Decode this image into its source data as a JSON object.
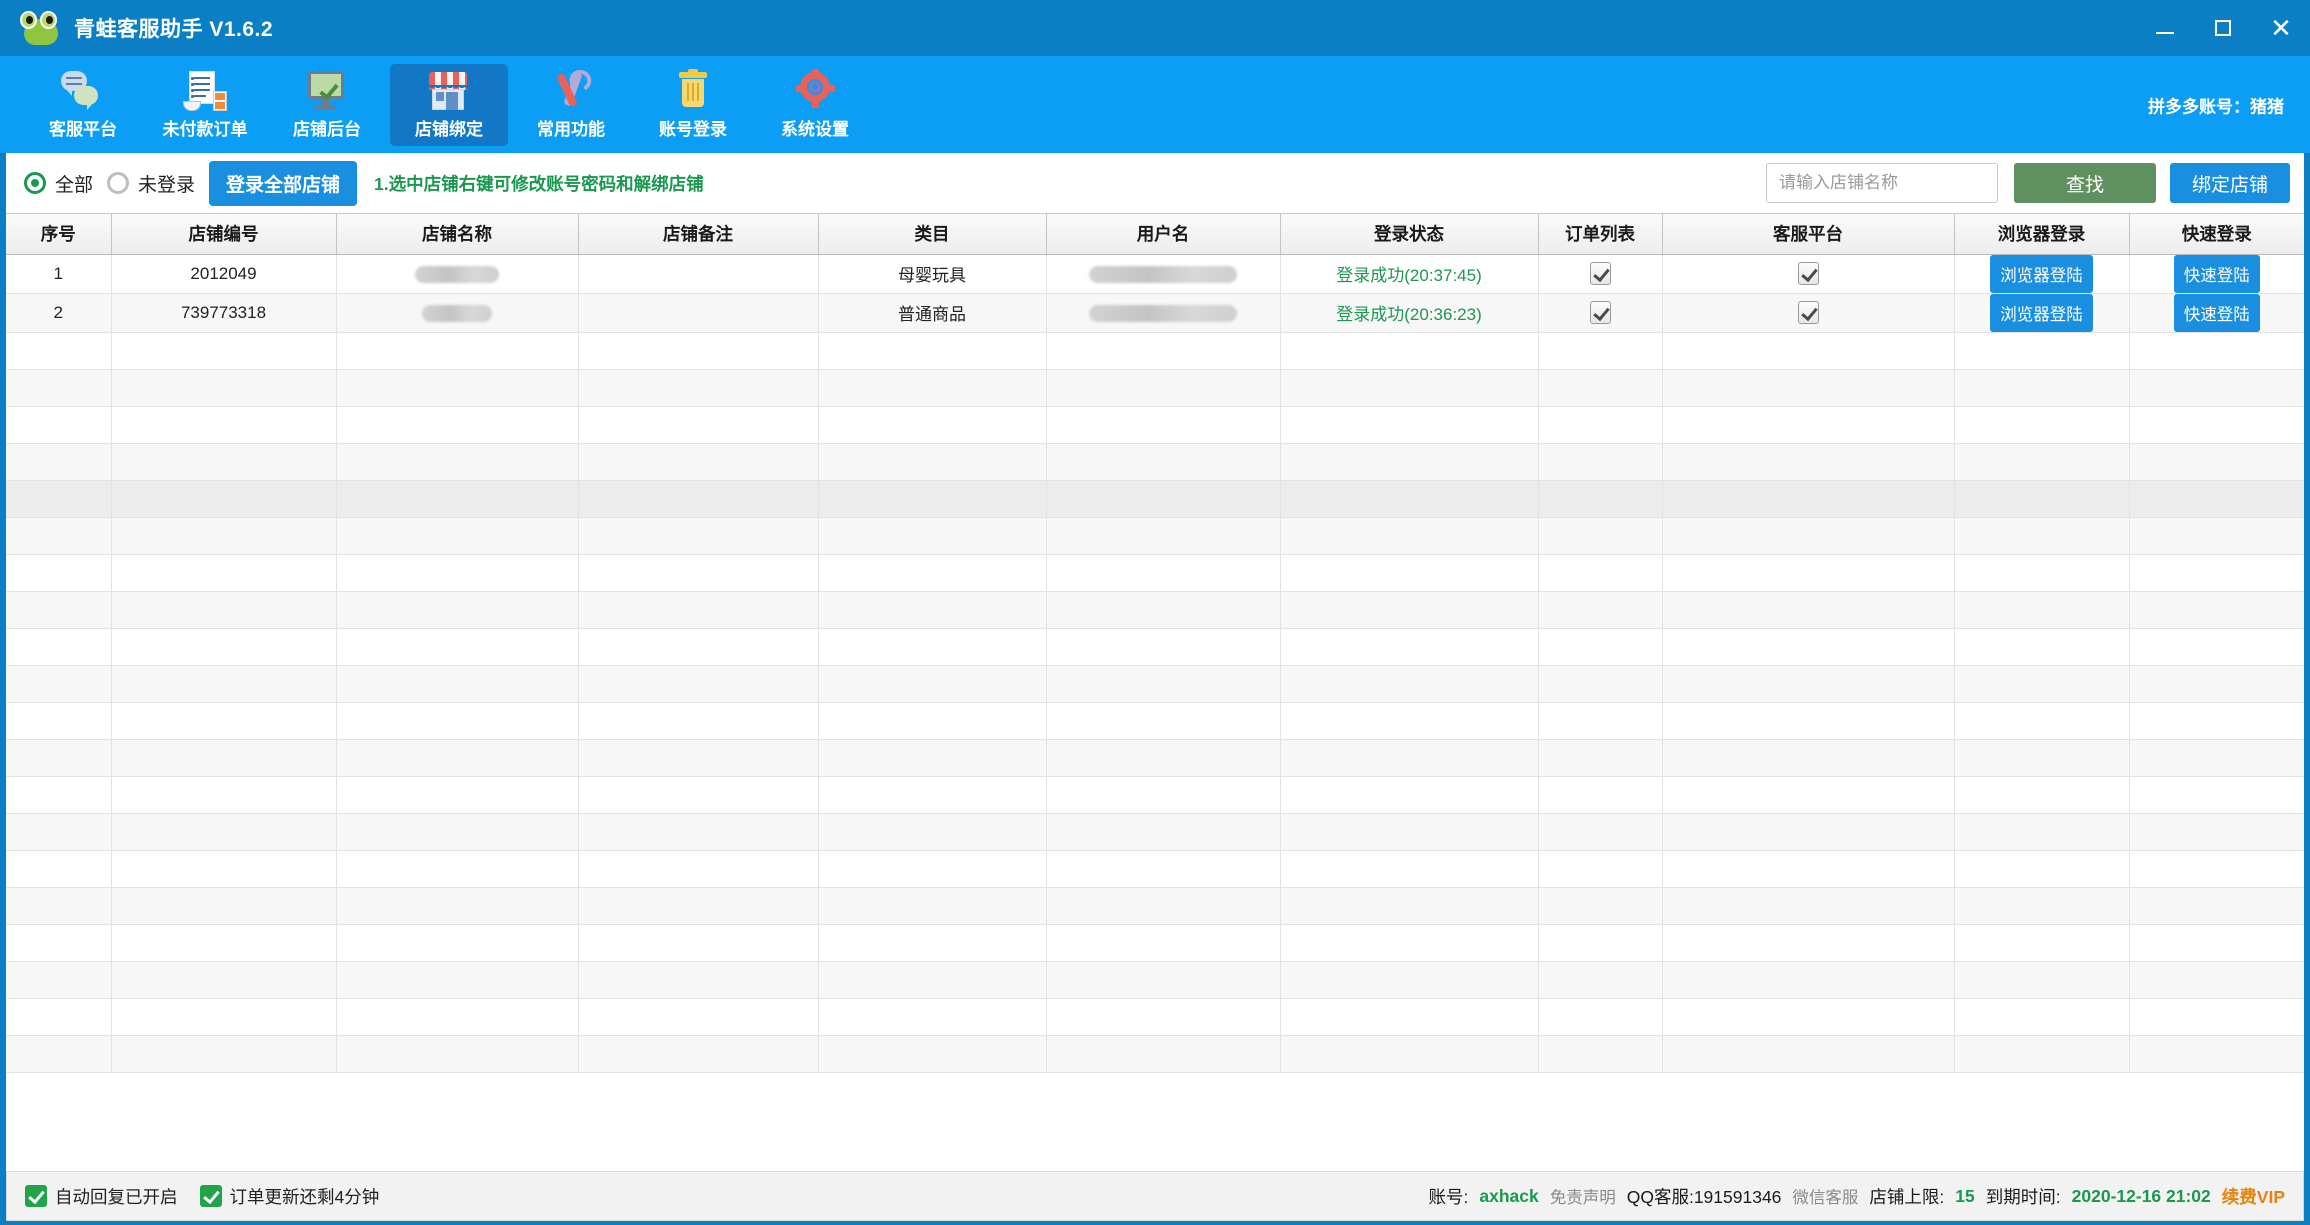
{
  "window": {
    "title": "青蛙客服助手 V1.6.2",
    "minimize": "—",
    "maximize": "□",
    "close": "✕"
  },
  "toolbar": {
    "items": [
      {
        "label": "客服平台",
        "icon": "chat-bubbles-icon",
        "active": false
      },
      {
        "label": "未付款订单",
        "icon": "invoice-hourglass-icon",
        "active": false
      },
      {
        "label": "店铺后台",
        "icon": "monitor-check-icon",
        "active": false
      },
      {
        "label": "店铺绑定",
        "icon": "storefront-icon",
        "active": true
      },
      {
        "label": "常用功能",
        "icon": "tools-icon",
        "active": false
      },
      {
        "label": "账号登录",
        "icon": "trash-bin-icon",
        "active": false
      },
      {
        "label": "系统设置",
        "icon": "gear-icon",
        "active": false
      }
    ],
    "account_label": "拼多多账号：猪猪"
  },
  "filterbar": {
    "radios": [
      {
        "label": "全部",
        "selected": true
      },
      {
        "label": "未登录",
        "selected": false
      }
    ],
    "login_all_button": "登录全部店铺",
    "hint": "1.选中店铺右键可修改账号密码和解绑店铺",
    "search_placeholder": "请输入店铺名称",
    "search_value": "",
    "find_button": "查找",
    "bind_button": "绑定店铺"
  },
  "table": {
    "headers": [
      "序号",
      "店铺编号",
      "店铺名称",
      "店铺备注",
      "类目",
      "用户名",
      "登录状态",
      "订单列表",
      "客服平台",
      "浏览器登录",
      "快速登录"
    ],
    "rows": [
      {
        "index": "1",
        "shop_id": "2012049",
        "shop_name": "",
        "shop_note": "",
        "category": "母婴玩具",
        "username": "",
        "login_status": "登录成功(20:37:45)",
        "order_list_checked": true,
        "service_platform_checked": true,
        "browser_login_button": "浏览器登陆",
        "quick_login_button": "快速登陆"
      },
      {
        "index": "2",
        "shop_id": "739773318",
        "shop_name": "",
        "shop_note": "",
        "category": "普通商品",
        "username": "",
        "login_status": "登录成功(20:36:23)",
        "order_list_checked": true,
        "service_platform_checked": true,
        "browser_login_button": "浏览器登陆",
        "quick_login_button": "快速登陆"
      }
    ],
    "empty_row_count": 20,
    "highlighted_empty_row_index": 4
  },
  "statusbar": {
    "auto_reply": "自动回复已开启",
    "order_refresh": "订单更新还剩4分钟",
    "account_label": "账号:",
    "account_name": "axhack",
    "disclaimer": "免责声明",
    "qq_service": "QQ客服:191591346",
    "wechat_service": "微信客服",
    "shop_limit_label": "店铺上限:",
    "shop_limit_value": "15",
    "expire_label": "到期时间:",
    "expire_value": "2020-12-16 21:02",
    "renew_vip": "续费VIP"
  },
  "colors": {
    "titlebar": "#0a7fc6",
    "toolbar": "#0c9ef5",
    "accent_blue": "#1a8fe0",
    "success_green": "#1a9850",
    "find_green": "#5f9160",
    "vip_orange": "#e8820c"
  }
}
